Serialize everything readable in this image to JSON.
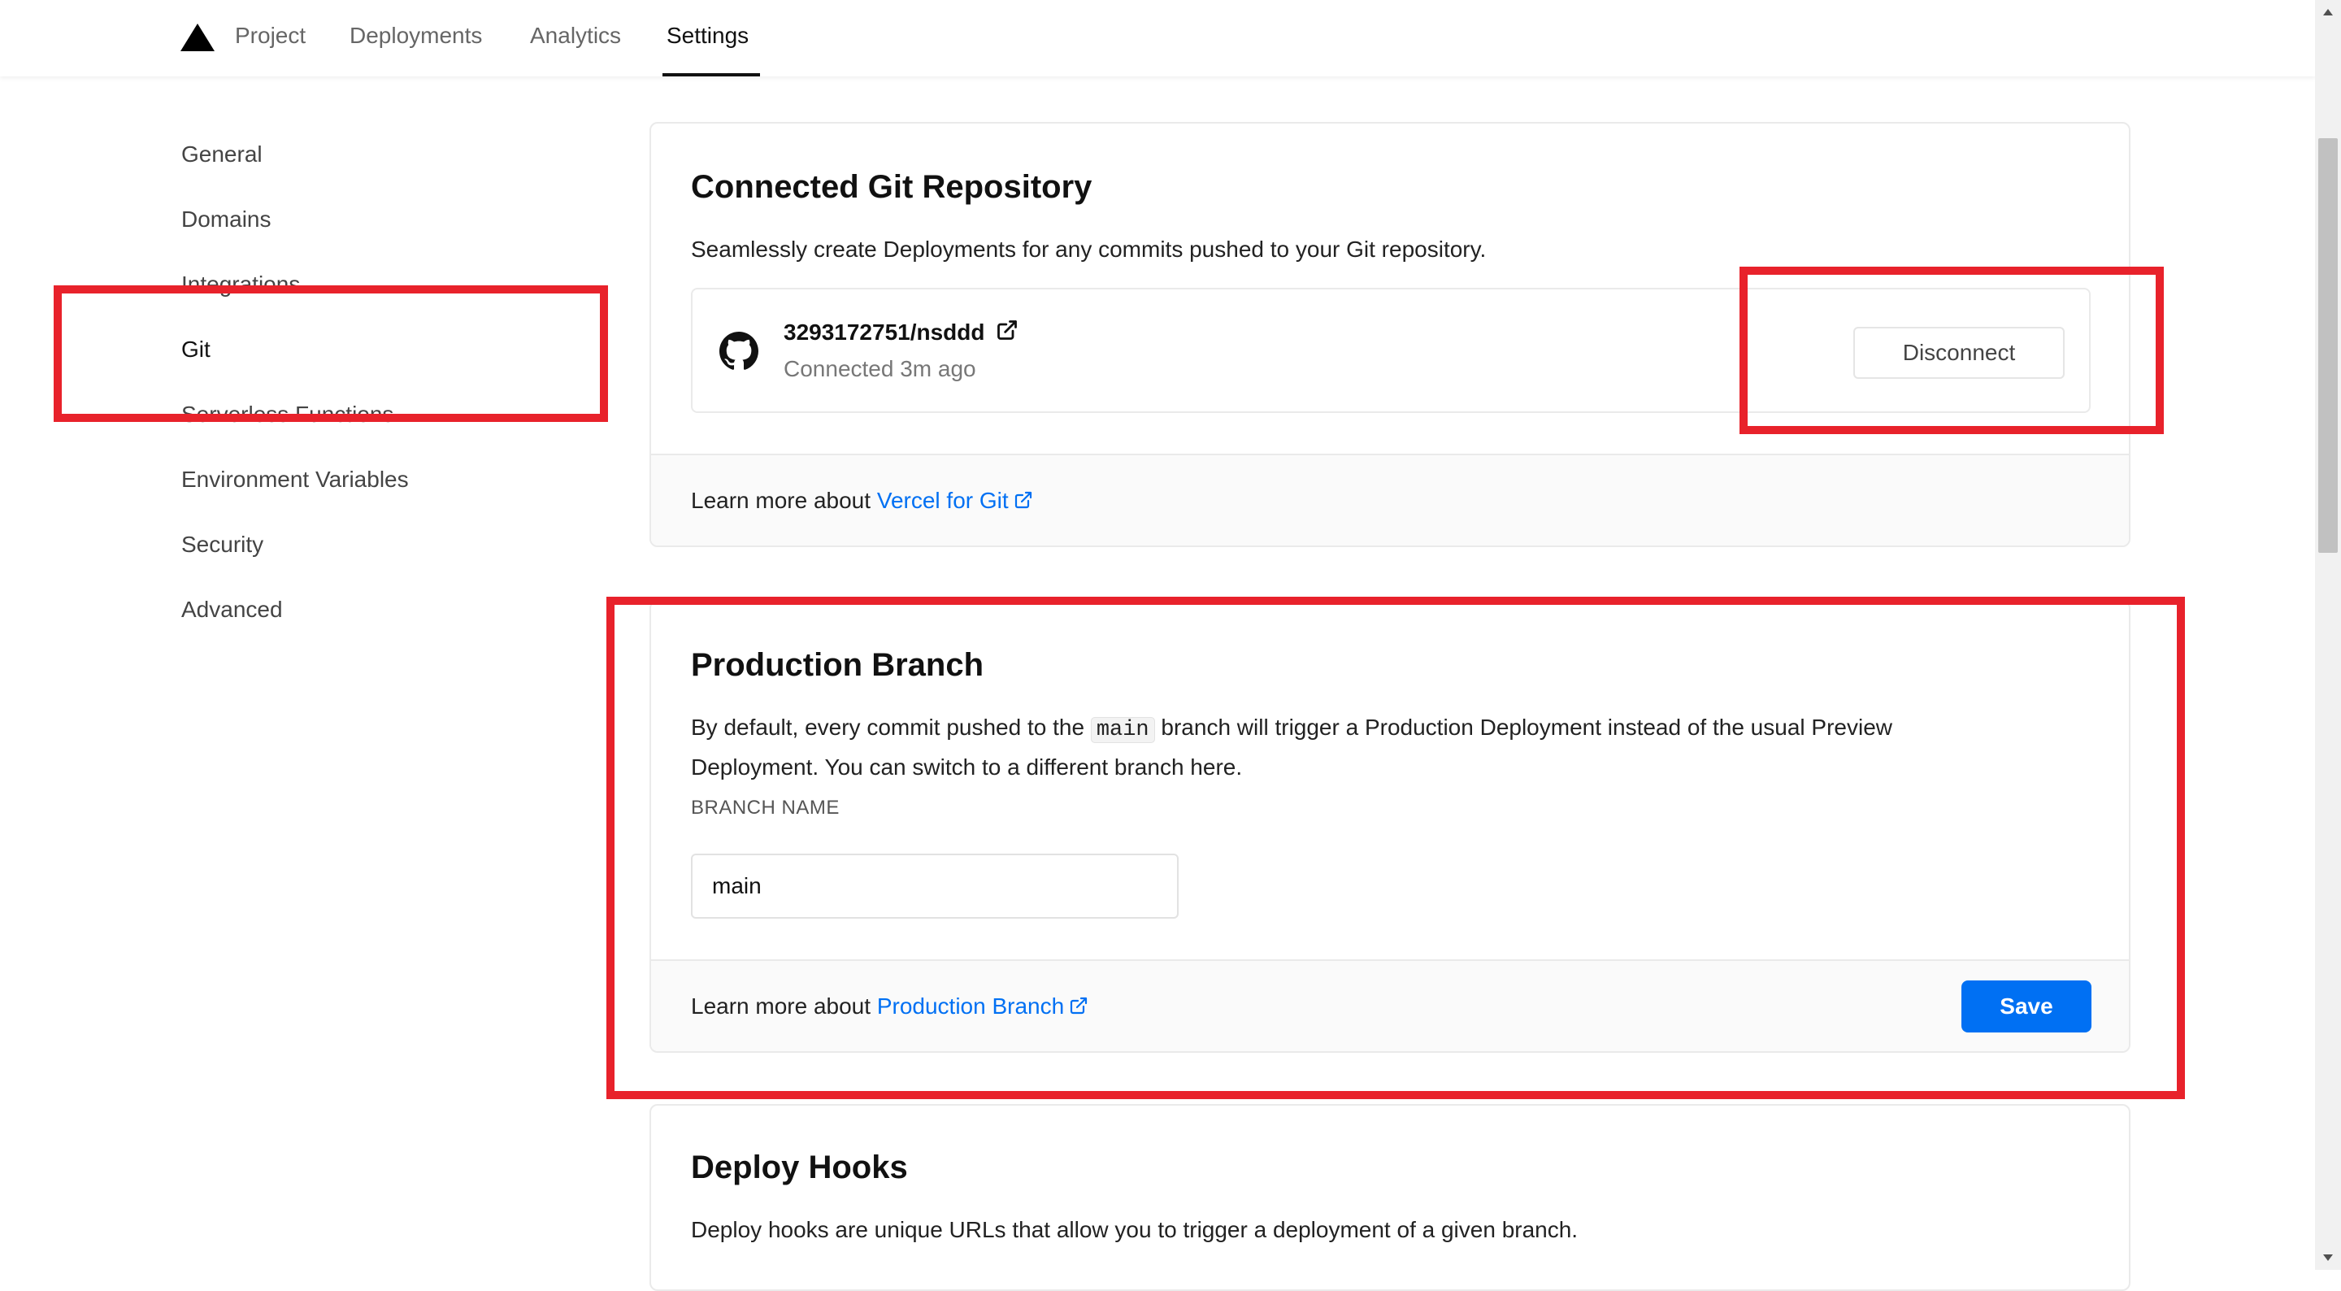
{
  "topnav": {
    "logo_icon": "vercel-triangle-icon",
    "tabs": [
      {
        "label": "Project"
      },
      {
        "label": "Deployments"
      },
      {
        "label": "Analytics"
      },
      {
        "label": "Settings",
        "active": true
      }
    ]
  },
  "sidebar": {
    "items": [
      {
        "label": "General"
      },
      {
        "label": "Domains"
      },
      {
        "label": "Integrations"
      },
      {
        "label": "Git",
        "active": true
      },
      {
        "label": "Serverless Functions"
      },
      {
        "label": "Environment Variables"
      },
      {
        "label": "Security"
      },
      {
        "label": "Advanced"
      }
    ]
  },
  "git_card": {
    "title": "Connected Git Repository",
    "description": "Seamlessly create Deployments for any commits pushed to your Git repository.",
    "repo": {
      "icon": "github-icon",
      "name": "3293172751/nsddd",
      "status": "Connected 3m ago"
    },
    "disconnect_label": "Disconnect",
    "footer_prefix": "Learn more about",
    "footer_link": "Vercel for Git"
  },
  "branch_card": {
    "title": "Production Branch",
    "description_before": "By default, every commit pushed to the",
    "description_code": "main",
    "description_after": "branch will trigger a Production Deployment instead of the usual Preview Deployment. You can switch to a different branch here.",
    "field_label": "BRANCH NAME",
    "field_value": "main",
    "footer_prefix": "Learn more about",
    "footer_link": "Production Branch",
    "save_label": "Save"
  },
  "hooks_card": {
    "title": "Deploy Hooks",
    "description": "Deploy hooks are unique URLs that allow you to trigger a deployment of a given branch."
  },
  "colors": {
    "accent": "#0070f3",
    "highlight": "#e8222b",
    "text": "#111111",
    "muted": "#666666"
  }
}
